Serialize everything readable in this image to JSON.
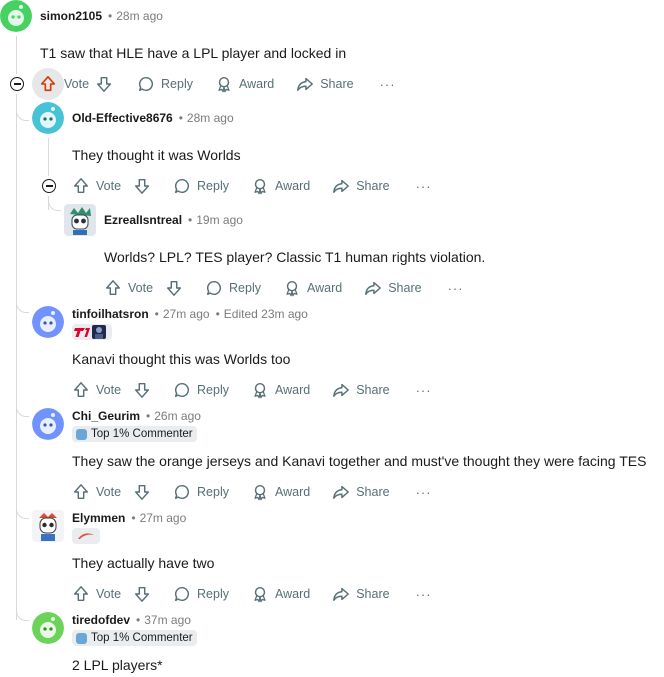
{
  "labels": {
    "vote": "Vote",
    "reply": "Reply",
    "award": "Award",
    "share": "Share",
    "more": "···"
  },
  "comments": [
    {
      "author": "simon2105",
      "time": "28m ago",
      "body": "T1 saw that HLE have a LPL player and locked in",
      "upvoted": true
    },
    {
      "author": "Old-Effective8676",
      "time": "28m ago",
      "body": "They thought it was Worlds"
    },
    {
      "author": "EzrealIsntreal",
      "time": "19m ago",
      "body": "Worlds? LPL? TES player? Classic T1 human rights violation."
    },
    {
      "author": "tinfoilhatsron",
      "time": "27m ago",
      "edited": "Edited 23m ago",
      "body": "Kanavi thought this was Worlds too"
    },
    {
      "author": "Chi_Geurim",
      "time": "26m ago",
      "flair": "Top 1% Commenter",
      "body": "They saw the orange jerseys and Kanavi together and must've thought they were facing TES"
    },
    {
      "author": "Elymmen",
      "time": "27m ago",
      "body": "They actually have two"
    },
    {
      "author": "tiredofdev",
      "time": "37m ago",
      "flair": "Top 1% Commenter",
      "body": "2 LPL players*"
    }
  ],
  "colors": {
    "upvote_active": "#d93a00",
    "avatar_green": "#46d160",
    "avatar_teal": "#24a0ed",
    "avatar_blue": "#7193ff",
    "muted": "#576f76"
  }
}
